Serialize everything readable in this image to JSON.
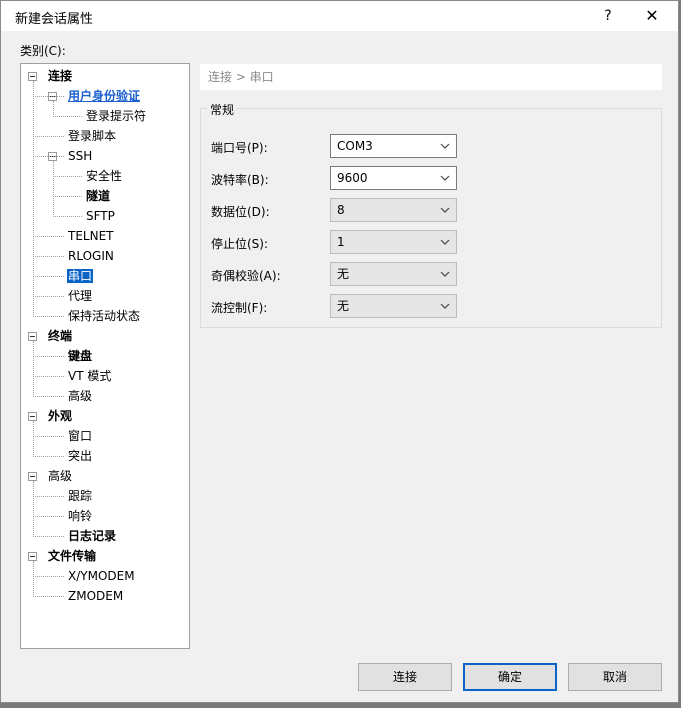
{
  "window": {
    "title": "新建会话属性",
    "help": "?",
    "close": "✕"
  },
  "category_label": "类别(C):",
  "tree": [
    {
      "label": "连接",
      "level": 0,
      "bold": true,
      "expandable": true
    },
    {
      "label": "用户身份验证",
      "level": 1,
      "link": true,
      "expandable": true
    },
    {
      "label": "登录提示符",
      "level": 2
    },
    {
      "label": "登录脚本",
      "level": 1
    },
    {
      "label": "SSH",
      "level": 1,
      "expandable": true
    },
    {
      "label": "安全性",
      "level": 2
    },
    {
      "label": "隧道",
      "level": 2,
      "bold": true
    },
    {
      "label": "SFTP",
      "level": 2
    },
    {
      "label": "TELNET",
      "level": 1
    },
    {
      "label": "RLOGIN",
      "level": 1
    },
    {
      "label": "串口",
      "level": 1,
      "selected": true
    },
    {
      "label": "代理",
      "level": 1
    },
    {
      "label": "保持活动状态",
      "level": 1
    },
    {
      "label": "终端",
      "level": 0,
      "bold": true,
      "expandable": true
    },
    {
      "label": "键盘",
      "level": 1,
      "bold": true
    },
    {
      "label": "VT 模式",
      "level": 1
    },
    {
      "label": "高级",
      "level": 1
    },
    {
      "label": "外观",
      "level": 0,
      "bold": true,
      "expandable": true
    },
    {
      "label": "窗口",
      "level": 1
    },
    {
      "label": "突出",
      "level": 1
    },
    {
      "label": "高级",
      "level": 0,
      "expandable": true
    },
    {
      "label": "跟踪",
      "level": 1
    },
    {
      "label": "响铃",
      "level": 1
    },
    {
      "label": "日志记录",
      "level": 1,
      "bold": true
    },
    {
      "label": "文件传输",
      "level": 0,
      "bold": true,
      "expandable": true
    },
    {
      "label": "X/YMODEM",
      "level": 1
    },
    {
      "label": "ZMODEM",
      "level": 1
    }
  ],
  "breadcrumb": "连接 > 串口",
  "group_title": "常规",
  "fields": [
    {
      "label": "端口号(P):",
      "value": "COM3",
      "enabled": true
    },
    {
      "label": "波特率(B):",
      "value": "9600",
      "enabled": true
    },
    {
      "label": "数据位(D):",
      "value": "8",
      "enabled": false
    },
    {
      "label": "停止位(S):",
      "value": "1",
      "enabled": false
    },
    {
      "label": "奇偶校验(A):",
      "value": "无",
      "enabled": false
    },
    {
      "label": "流控制(F):",
      "value": "无",
      "enabled": false
    }
  ],
  "buttons": {
    "connect": "连接",
    "ok": "确定",
    "cancel": "取消"
  }
}
